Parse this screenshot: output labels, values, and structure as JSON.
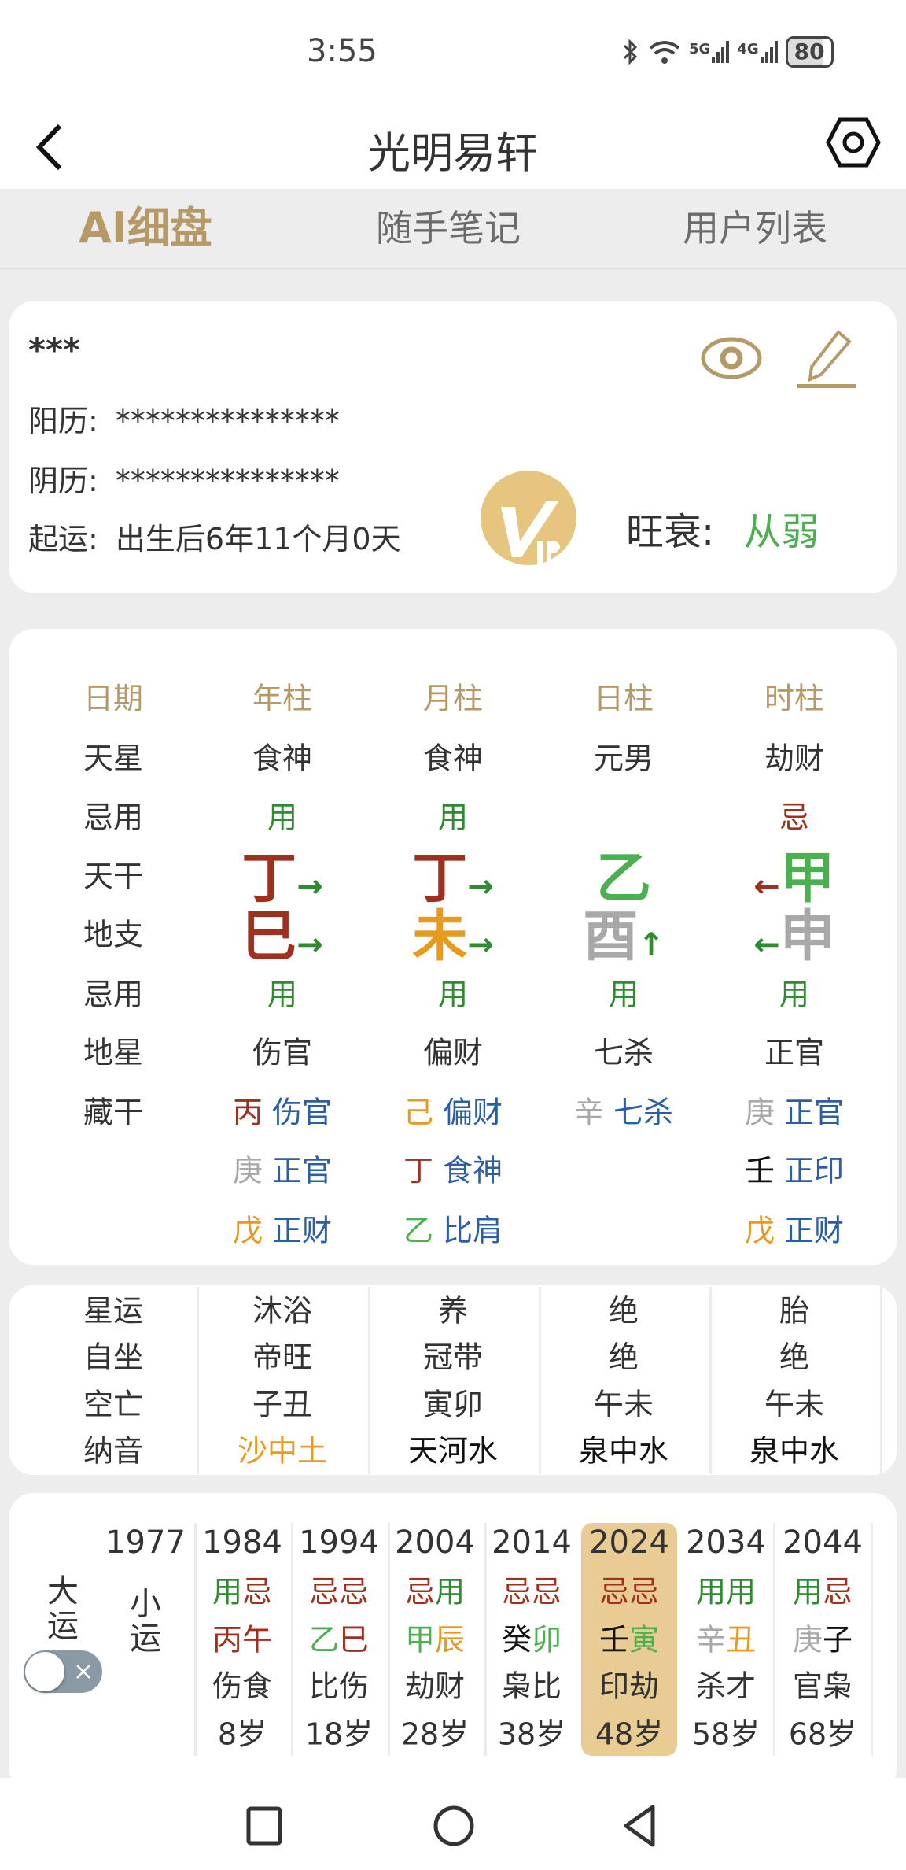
{
  "status_bar": {
    "time": "3:55",
    "icons": [
      "bluetooth-icon",
      "wifi-icon",
      "5g-signal-icon",
      "4g-signal-icon"
    ],
    "network_5g": "5G",
    "network_4g": "4G",
    "battery": "80"
  },
  "header": {
    "title": "光明易轩",
    "back_icon": "chevron-left-icon",
    "settings_icon": "hexagon-settings-icon"
  },
  "tabs": [
    {
      "label": "AI细盘",
      "active": true
    },
    {
      "label": "随手笔记",
      "active": false
    },
    {
      "label": "用户列表",
      "active": false
    }
  ],
  "profile": {
    "name": "***",
    "solar_label": "阳历:",
    "solar_value": "***************",
    "lunar_label": "阴历:",
    "lunar_value": "***************",
    "luck_start_label": "起运:",
    "luck_start_value": "出生后6年11个月0天",
    "strength_label": "旺衰:",
    "strength_value": "从弱",
    "vip_badge": "VIP",
    "view_icon": "eye-icon",
    "edit_icon": "pencil-icon"
  },
  "colors": {
    "accent_gold": "#B59A68",
    "fire_red": "#A0301E",
    "wood_green": "#4CAF50",
    "useful_green": "#2E8B2E",
    "metal_gray": "#A8A8A8",
    "earth_orange": "#E89A1E",
    "ten_god_blue": "#2A5FA8",
    "highlight": "#E8CC94"
  },
  "pillars": {
    "headers": [
      "日期",
      "年柱",
      "月柱",
      "日柱",
      "时柱"
    ],
    "row_labels": {
      "tian_xing": "天星",
      "ji_yong_top": "忌用",
      "tian_gan": "天干",
      "di_zhi": "地支",
      "ji_yong_bottom": "忌用",
      "di_xing": "地星",
      "cang_gan": "藏干"
    },
    "columns": [
      {
        "tian_xing": "食神",
        "ji_yong_top": "用",
        "tian_gan": "丁",
        "tian_gan_arrow": "→",
        "di_zhi": "巳",
        "di_zhi_arrow": "→",
        "ji_yong_bottom": "用",
        "di_xing": "伤官",
        "cang_gan": [
          {
            "stem": "丙",
            "god": "伤官"
          },
          {
            "stem": "庚",
            "god": "正官"
          },
          {
            "stem": "戊",
            "god": "正财"
          }
        ]
      },
      {
        "tian_xing": "食神",
        "ji_yong_top": "用",
        "tian_gan": "丁",
        "tian_gan_arrow": "→",
        "di_zhi": "未",
        "di_zhi_arrow": "→",
        "ji_yong_bottom": "用",
        "di_xing": "偏财",
        "cang_gan": [
          {
            "stem": "己",
            "god": "偏财"
          },
          {
            "stem": "丁",
            "god": "食神"
          },
          {
            "stem": "乙",
            "god": "比肩"
          }
        ]
      },
      {
        "tian_xing": "元男",
        "ji_yong_top": "",
        "tian_gan": "乙",
        "tian_gan_arrow": "",
        "di_zhi": "酉",
        "di_zhi_arrow": "↑",
        "ji_yong_bottom": "用",
        "di_xing": "七杀",
        "cang_gan": [
          {
            "stem": "辛",
            "god": "七杀"
          }
        ]
      },
      {
        "tian_xing": "劫财",
        "ji_yong_top": "忌",
        "tian_gan": "甲",
        "tian_gan_arrow": "←",
        "di_zhi": "申",
        "di_zhi_arrow": "←",
        "ji_yong_bottom": "用",
        "di_xing": "正官",
        "cang_gan": [
          {
            "stem": "庚",
            "god": "正官"
          },
          {
            "stem": "壬",
            "god": "正印"
          },
          {
            "stem": "戊",
            "god": "正财"
          }
        ]
      }
    ]
  },
  "extra": {
    "row_labels": [
      "星运",
      "自坐",
      "空亡",
      "纳音"
    ],
    "columns": [
      [
        "沐浴",
        "帝旺",
        "子丑",
        "沙中土"
      ],
      [
        "养",
        "冠带",
        "寅卯",
        "天河水"
      ],
      [
        "绝",
        "绝",
        "午未",
        "泉中水"
      ],
      [
        "胎",
        "绝",
        "午未",
        "泉中水"
      ]
    ]
  },
  "luck": {
    "da_yun_label": "大运",
    "xiao_yun_label": "小运",
    "toggle_on": false,
    "start_year": "1977",
    "selected_index": 5,
    "periods": [
      {
        "year": "1984",
        "ji_yong": [
          "用",
          "忌"
        ],
        "ganzhi": [
          "丙",
          "午"
        ],
        "gods": "伤食",
        "age": "8岁"
      },
      {
        "year": "1994",
        "ji_yong": [
          "忌",
          "忌"
        ],
        "ganzhi": [
          "乙",
          "巳"
        ],
        "gods": "比伤",
        "age": "18岁"
      },
      {
        "year": "2004",
        "ji_yong": [
          "忌",
          "用"
        ],
        "ganzhi": [
          "甲",
          "辰"
        ],
        "gods": "劫财",
        "age": "28岁"
      },
      {
        "year": "2014",
        "ji_yong": [
          "忌",
          "忌"
        ],
        "ganzhi": [
          "癸",
          "卯"
        ],
        "gods": "枭比",
        "age": "38岁"
      },
      {
        "year": "2024",
        "ji_yong": [
          "忌",
          "忌"
        ],
        "ganzhi": [
          "壬",
          "寅"
        ],
        "gods": "印劫",
        "age": "48岁"
      },
      {
        "year": "2034",
        "ji_yong": [
          "用",
          "用"
        ],
        "ganzhi": [
          "辛",
          "丑"
        ],
        "gods": "杀才",
        "age": "58岁"
      },
      {
        "year": "2044",
        "ji_yong": [
          "用",
          "忌"
        ],
        "ganzhi": [
          "庚",
          "子"
        ],
        "gods": "官枭",
        "age": "68岁"
      }
    ]
  },
  "nav_bar": {
    "icons": [
      "recents-square-icon",
      "home-circle-icon",
      "back-triangle-icon"
    ]
  }
}
